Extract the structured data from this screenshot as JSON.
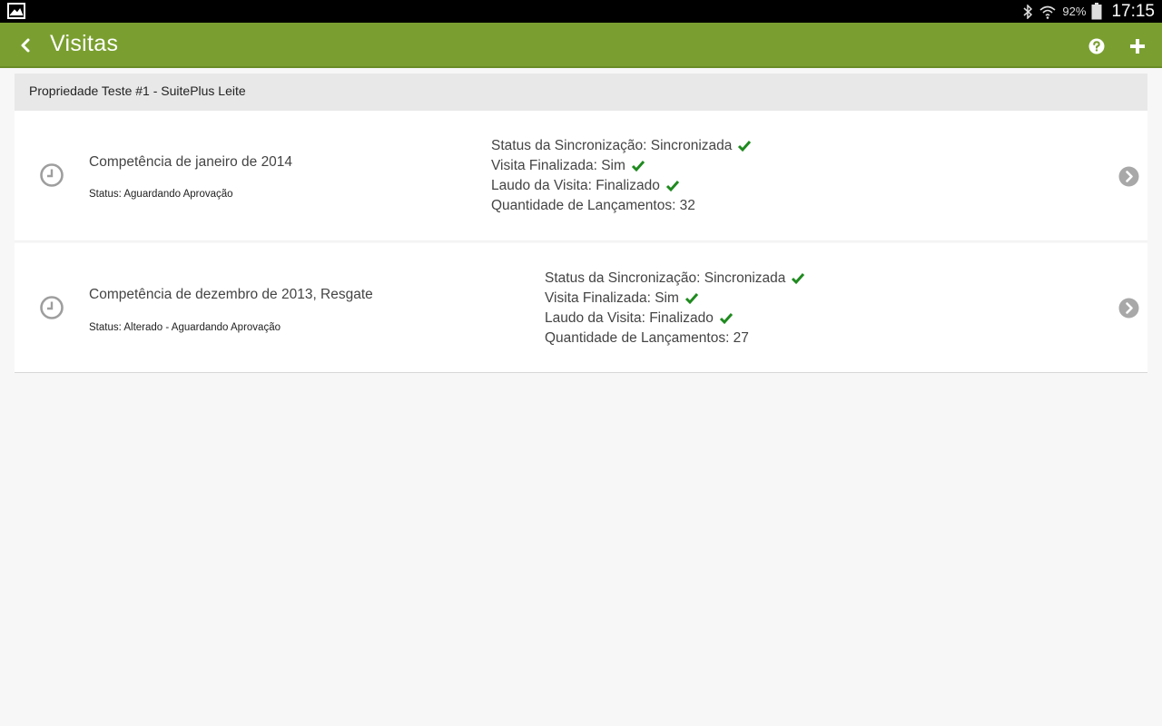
{
  "status_bar": {
    "battery": "92%",
    "time": "17:15"
  },
  "action_bar": {
    "title": "Visitas"
  },
  "property_header": "Propriedade Teste #1 - SuitePlus Leite",
  "visits": [
    {
      "title": "Competência de janeiro de 2014",
      "status": "Status: Aguardando Aprovação",
      "sync": "Status da Sincronização: Sincronizada",
      "finalizada": "Visita Finalizada: Sim",
      "laudo": "Laudo da Visita: Finalizado",
      "quantidade": "Quantidade de Lançamentos: 32"
    },
    {
      "title": "Competência de dezembro de 2013, Resgate",
      "status": "Status: Alterado - Aguardando Aprovação",
      "sync": "Status da Sincronização: Sincronizada",
      "finalizada": "Visita Finalizada: Sim",
      "laudo": "Laudo da Visita: Finalizado",
      "quantidade": "Quantidade de Lançamentos: 27"
    }
  ],
  "colors": {
    "action_bar": "#7a9f30",
    "check": "#1f8a1f",
    "icon_gray": "#9e9e9e"
  },
  "icons": {
    "back": "chevron-left-icon",
    "help": "help-icon",
    "add": "plus-icon",
    "row_leading": "clock-icon",
    "row_trailing": "chevron-right-circle-icon",
    "check": "check-icon"
  }
}
